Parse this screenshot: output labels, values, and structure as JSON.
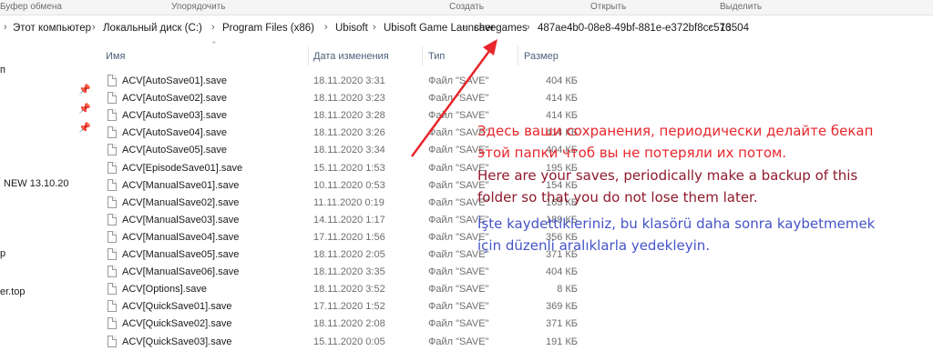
{
  "ribbon": {
    "labels": [
      "Буфер обмена",
      "Упорядочить",
      "Создать",
      "Открыть",
      "Выделить"
    ]
  },
  "address": {
    "crumbs": [
      "Этот компьютер",
      "Локальный диск (C:)",
      "Program Files (x86)",
      "Ubisoft",
      "Ubisoft Game Launcher",
      "savegames",
      "487ae4b0-08e8-49bf-881e-e372bf8cc576",
      "13504"
    ]
  },
  "sidebar": {
    "items": [
      "п",
      "NEW 13.10.20",
      "р",
      "er.top"
    ]
  },
  "columns": {
    "name": "Имя",
    "date": "Дата изменения",
    "type": "Тип",
    "size": "Размер"
  },
  "files": [
    {
      "name": "ACV[AutoSave01].save",
      "date": "18.11.2020 3:31",
      "type": "Файл \"SAVE\"",
      "size": "404 КБ"
    },
    {
      "name": "ACV[AutoSave02].save",
      "date": "18.11.2020 3:23",
      "type": "Файл \"SAVE\"",
      "size": "414 КБ"
    },
    {
      "name": "ACV[AutoSave03].save",
      "date": "18.11.2020 3:28",
      "type": "Файл \"SAVE\"",
      "size": "414 КБ"
    },
    {
      "name": "ACV[AutoSave04].save",
      "date": "18.11.2020 3:26",
      "type": "Файл \"SAVE\"",
      "size": "414 КБ"
    },
    {
      "name": "ACV[AutoSave05].save",
      "date": "18.11.2020 3:34",
      "type": "Файл \"SAVE\"",
      "size": "404 КБ"
    },
    {
      "name": "ACV[EpisodeSave01].save",
      "date": "15.11.2020 1:53",
      "type": "Файл \"SAVE\"",
      "size": "195 КБ"
    },
    {
      "name": "ACV[ManualSave01].save",
      "date": "10.11.2020 0:53",
      "type": "Файл \"SAVE\"",
      "size": "154 КБ"
    },
    {
      "name": "ACV[ManualSave02].save",
      "date": "11.11.2020 0:19",
      "type": "Файл \"SAVE\"",
      "size": "163 КБ"
    },
    {
      "name": "ACV[ManualSave03].save",
      "date": "14.11.2020 1:17",
      "type": "Файл \"SAVE\"",
      "size": "189 КБ"
    },
    {
      "name": "ACV[ManualSave04].save",
      "date": "17.11.2020 1:56",
      "type": "Файл \"SAVE\"",
      "size": "356 КБ"
    },
    {
      "name": "ACV[ManualSave05].save",
      "date": "18.11.2020 2:05",
      "type": "Файл \"SAVE\"",
      "size": "371 КБ"
    },
    {
      "name": "ACV[ManualSave06].save",
      "date": "18.11.2020 3:35",
      "type": "Файл \"SAVE\"",
      "size": "404 КБ"
    },
    {
      "name": "ACV[Options].save",
      "date": "18.11.2020 3:52",
      "type": "Файл \"SAVE\"",
      "size": "8 КБ"
    },
    {
      "name": "ACV[QuickSave01].save",
      "date": "17.11.2020 1:52",
      "type": "Файл \"SAVE\"",
      "size": "369 КБ"
    },
    {
      "name": "ACV[QuickSave02].save",
      "date": "18.11.2020 2:08",
      "type": "Файл \"SAVE\"",
      "size": "371 КБ"
    },
    {
      "name": "ACV[QuickSave03].save",
      "date": "15.11.2020 0:05",
      "type": "Файл \"SAVE\"",
      "size": "191 КБ"
    }
  ],
  "notes": {
    "ru_line1": "Здесь ваши сохранения, периодически делайте бекап",
    "ru_line2": "этой папки чтоб вы не потеряли их потом.",
    "en_line1": "Here are your saves, periodically make a backup of this",
    "en_line2": "folder so that you do not lose them later.",
    "tr_line1": "İşte kaydettikleriniz, bu klasörü daha sonra kaybetmemek",
    "tr_line2": "için düzenli aralıklarla yedekleyin."
  },
  "colors": {
    "ru_text": "#e8262b",
    "en_text": "#8f1a2c",
    "tr_text": "#4554c8",
    "arrow": "#e8262b"
  }
}
